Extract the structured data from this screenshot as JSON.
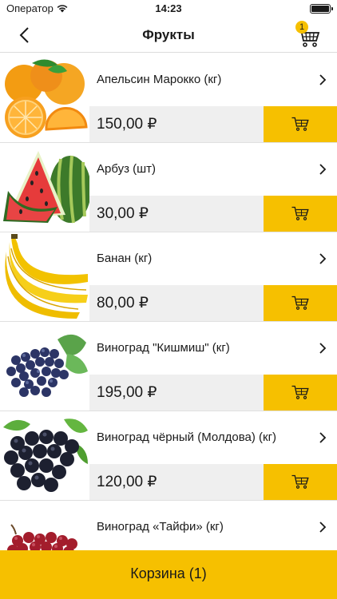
{
  "status_bar": {
    "carrier": "Оператор",
    "time": "14:23",
    "wifi_icon": "wifi-icon",
    "battery_icon": "battery-icon"
  },
  "nav": {
    "back_icon": "chevron-left-icon",
    "title": "Фрукты",
    "cart_icon": "cart-icon",
    "cart_badge": "1"
  },
  "products": [
    {
      "name": "Апельсин Марокко (кг)",
      "price": "150,00 ₽",
      "image": "orange"
    },
    {
      "name": "Арбуз (шт)",
      "price": "30,00 ₽",
      "image": "watermelon"
    },
    {
      "name": "Банан (кг)",
      "price": "80,00 ₽",
      "image": "banana"
    },
    {
      "name": "Виноград \"Кишмиш\" (кг)",
      "price": "195,00 ₽",
      "image": "grapes-blue"
    },
    {
      "name": "Виноград чёрный (Молдова) (кг)",
      "price": "120,00 ₽",
      "image": "grapes-black"
    },
    {
      "name": "Виноград «Тайфи» (кг)",
      "price": "",
      "image": "grapes-red"
    }
  ],
  "bottom_button": {
    "label": "Корзина (1)"
  },
  "colors": {
    "accent": "#f6c000",
    "price_bg": "#efefef"
  }
}
